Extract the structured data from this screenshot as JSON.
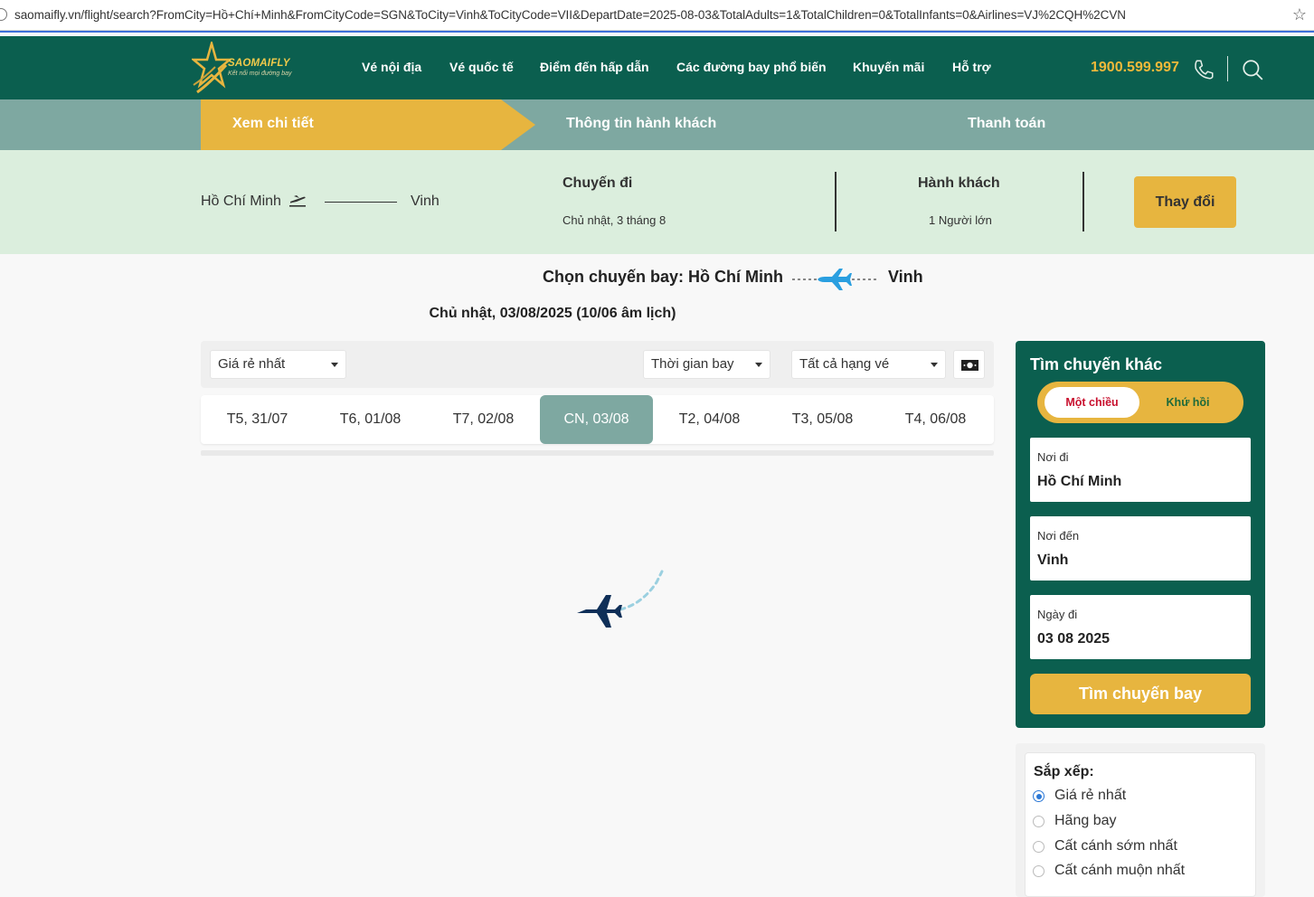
{
  "browser": {
    "url": "saomaifly.vn/flight/search?FromCity=Hồ+Chí+Minh&FromCityCode=SGN&ToCity=Vinh&ToCityCode=VII&DepartDate=2025-08-03&TotalAdults=1&TotalChildren=0&TotalInfants=0&Airlines=VJ%2CQH%2CVN"
  },
  "header": {
    "logo_text": "SAOMAIFLY",
    "logo_tagline": "Kết nối mọi đường bay",
    "nav": [
      "Vé nội địa",
      "Vé quốc tế",
      "Điểm đến hấp dẫn",
      "Các đường bay phổ biến",
      "Khuyến mãi",
      "Hỗ trợ"
    ],
    "hotline": "1900.599.997"
  },
  "steps": [
    "Xem chi tiết",
    "Thông tin hành khách",
    "Thanh toán"
  ],
  "summary": {
    "from": "Hồ Chí Minh",
    "to": "Vinh",
    "trip_label": "Chuyến đi",
    "trip_date": "Chủ nhật, 3 tháng 8",
    "passenger_label": "Hành khách",
    "passenger_value": "1 Người lớn",
    "change_button": "Thay đổi"
  },
  "route": {
    "prefix": "Chọn chuyến bay: Hồ Chí Minh",
    "to": "Vinh",
    "date": "Chủ nhật, 03/08/2025 (10/06 âm lịch)"
  },
  "filters": {
    "price": "Giá rẻ nhất",
    "time": "Thời gian bay",
    "class": "Tất cả hạng vé"
  },
  "dates": [
    "T5, 31/07",
    "T6, 01/08",
    "T7, 02/08",
    "CN, 03/08",
    "T2, 04/08",
    "T3, 05/08",
    "T4, 06/08"
  ],
  "active_date_index": 3,
  "search_panel": {
    "title": "Tìm chuyến khác",
    "one_way": "Một chiều",
    "round_trip": "Khứ hồi",
    "from_label": "Nơi đi",
    "from_value": "Hồ Chí Minh",
    "to_label": "Nơi đến",
    "to_value": "Vinh",
    "date_label": "Ngày đi",
    "date_value": "03 08 2025",
    "find_button": "Tìm chuyến bay"
  },
  "sort": {
    "title": "Sắp xếp:",
    "options": [
      "Giá rẻ nhất",
      "Hãng bay",
      "Cất cánh sớm nhất",
      "Cất cánh muộn nhất"
    ],
    "selected_index": 0
  },
  "colors": {
    "header_green": "#0b5f4f",
    "accent_gold": "#e7b53f",
    "step_teal": "#7ea8a1",
    "summary_bg": "#dbeedd"
  }
}
